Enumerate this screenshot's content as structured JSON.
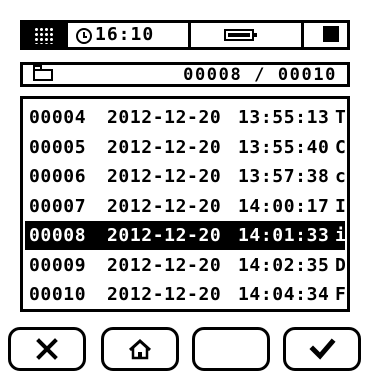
{
  "status_bar": {
    "time": "16:10",
    "icons": [
      "menu-grid-icon",
      "clock-icon",
      "battery-icon",
      "square-icon"
    ]
  },
  "page_bar": {
    "icon": "folder-icon",
    "counter": "00008 / 00010"
  },
  "records": [
    {
      "id": "00004",
      "date": "2012-12-20",
      "time": "13:55:13",
      "flag": "T"
    },
    {
      "id": "00005",
      "date": "2012-12-20",
      "time": "13:55:40",
      "flag": "C"
    },
    {
      "id": "00006",
      "date": "2012-12-20",
      "time": "13:57:38",
      "flag": "c"
    },
    {
      "id": "00007",
      "date": "2012-12-20",
      "time": "14:00:17",
      "flag": "I"
    },
    {
      "id": "00008",
      "date": "2012-12-20",
      "time": "14:01:33",
      "flag": "i"
    },
    {
      "id": "00009",
      "date": "2012-12-20",
      "time": "14:02:35",
      "flag": "D"
    },
    {
      "id": "00010",
      "date": "2012-12-20",
      "time": "14:04:34",
      "flag": "F"
    }
  ],
  "selected_record": "00008",
  "buttons": [
    {
      "name": "cancel-button",
      "icon": "x-icon"
    },
    {
      "name": "home-button",
      "icon": "home-icon"
    },
    {
      "name": "blank-button",
      "icon": ""
    },
    {
      "name": "confirm-button",
      "icon": "checkmark-icon"
    }
  ]
}
